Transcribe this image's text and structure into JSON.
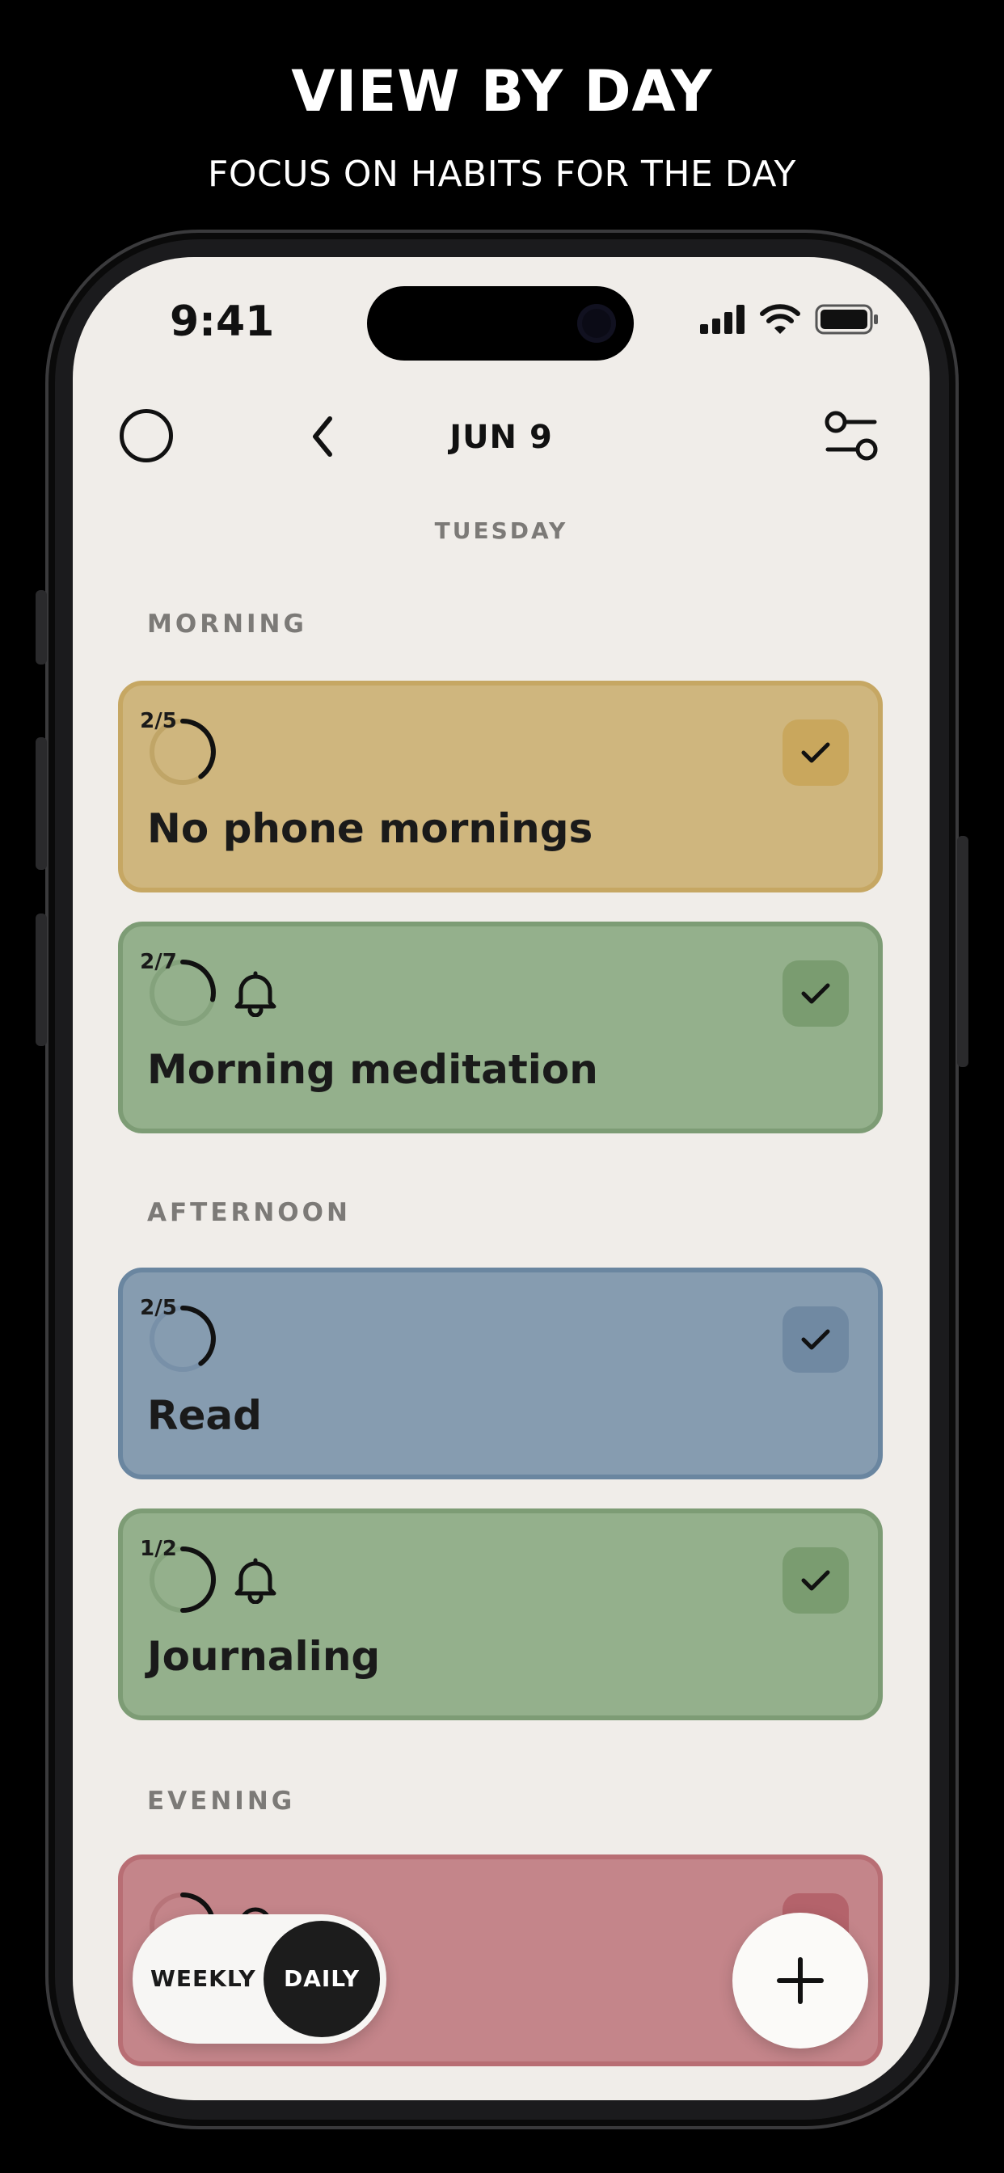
{
  "promo": {
    "title": "VIEW BY DAY",
    "subtitle": "FOCUS ON HABITS FOR THE DAY"
  },
  "status_bar": {
    "time": "9:41",
    "icons": [
      "cellular-signal-icon",
      "wifi-icon",
      "battery-icon"
    ]
  },
  "nav": {
    "date": "JUN 9",
    "weekday": "TUESDAY"
  },
  "sections": [
    {
      "label": "MORNING",
      "habits": [
        {
          "progress_label": "2/5",
          "progress_fraction": 0.4,
          "has_reminder": false,
          "name": "No phone mornings",
          "color": "#cfb67e",
          "completed": true
        },
        {
          "progress_label": "2/7",
          "progress_fraction": 0.2857,
          "has_reminder": true,
          "name": "Morning meditation",
          "color": "#94b08c",
          "completed": true
        }
      ]
    },
    {
      "label": "AFTERNOON",
      "habits": [
        {
          "progress_label": "2/5",
          "progress_fraction": 0.4,
          "has_reminder": false,
          "name": "Read",
          "color": "#869cb0",
          "completed": true
        },
        {
          "progress_label": "1/2",
          "progress_fraction": 0.5,
          "has_reminder": true,
          "name": "Journaling",
          "color": "#94b08c",
          "completed": true
        }
      ]
    },
    {
      "label": "EVENING",
      "habits": [
        {
          "progress_label": "",
          "progress_fraction": 0.4,
          "has_reminder": true,
          "name": "",
          "color": "#c4858a",
          "completed": true
        }
      ]
    }
  ],
  "view_toggle": {
    "weekly_label": "WEEKLY",
    "daily_label": "DAILY",
    "selected": "DAILY"
  },
  "colors": {
    "background": "#f0ede9",
    "yellow": "#cfb67e",
    "green": "#94b08c",
    "blue": "#869cb0",
    "red": "#c4858a"
  }
}
